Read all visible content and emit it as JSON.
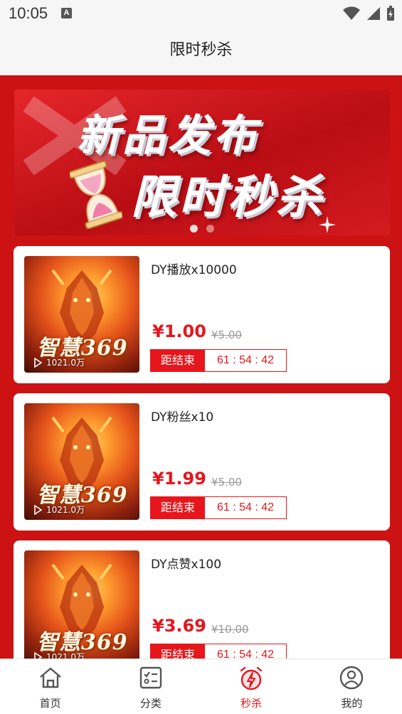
{
  "status_bar": {
    "time": "10:05",
    "notification_letter": "A"
  },
  "header": {
    "title": "限时秒杀"
  },
  "banner": {
    "line1": "新品发布",
    "line2": "限时秒杀",
    "dots": 2,
    "active_dot": 0
  },
  "thumbnail": {
    "caption": "智慧369",
    "plays": "1021.0万"
  },
  "products": [
    {
      "name": "DY播放x10000",
      "price": "¥1.00",
      "original_price": "¥5.00",
      "countdown_label": "距结束",
      "countdown": "61 : 54 : 42"
    },
    {
      "name": "DY粉丝x10",
      "price": "¥1.99",
      "original_price": "¥5.00",
      "countdown_label": "距结束",
      "countdown": "61 : 54 : 42"
    },
    {
      "name": "DY点赞x100",
      "price": "¥3.69",
      "original_price": "¥10.00",
      "countdown_label": "距结束",
      "countdown": "61 : 54 : 42"
    }
  ],
  "tabbar": {
    "items": [
      {
        "label": "首页",
        "icon": "home-icon"
      },
      {
        "label": "分类",
        "icon": "checklist-icon"
      },
      {
        "label": "秒杀",
        "icon": "alarm-flash-icon",
        "active": true
      },
      {
        "label": "我的",
        "icon": "user-icon"
      }
    ]
  },
  "colors": {
    "accent": "#e6161c",
    "background_red": "#cc1212"
  }
}
